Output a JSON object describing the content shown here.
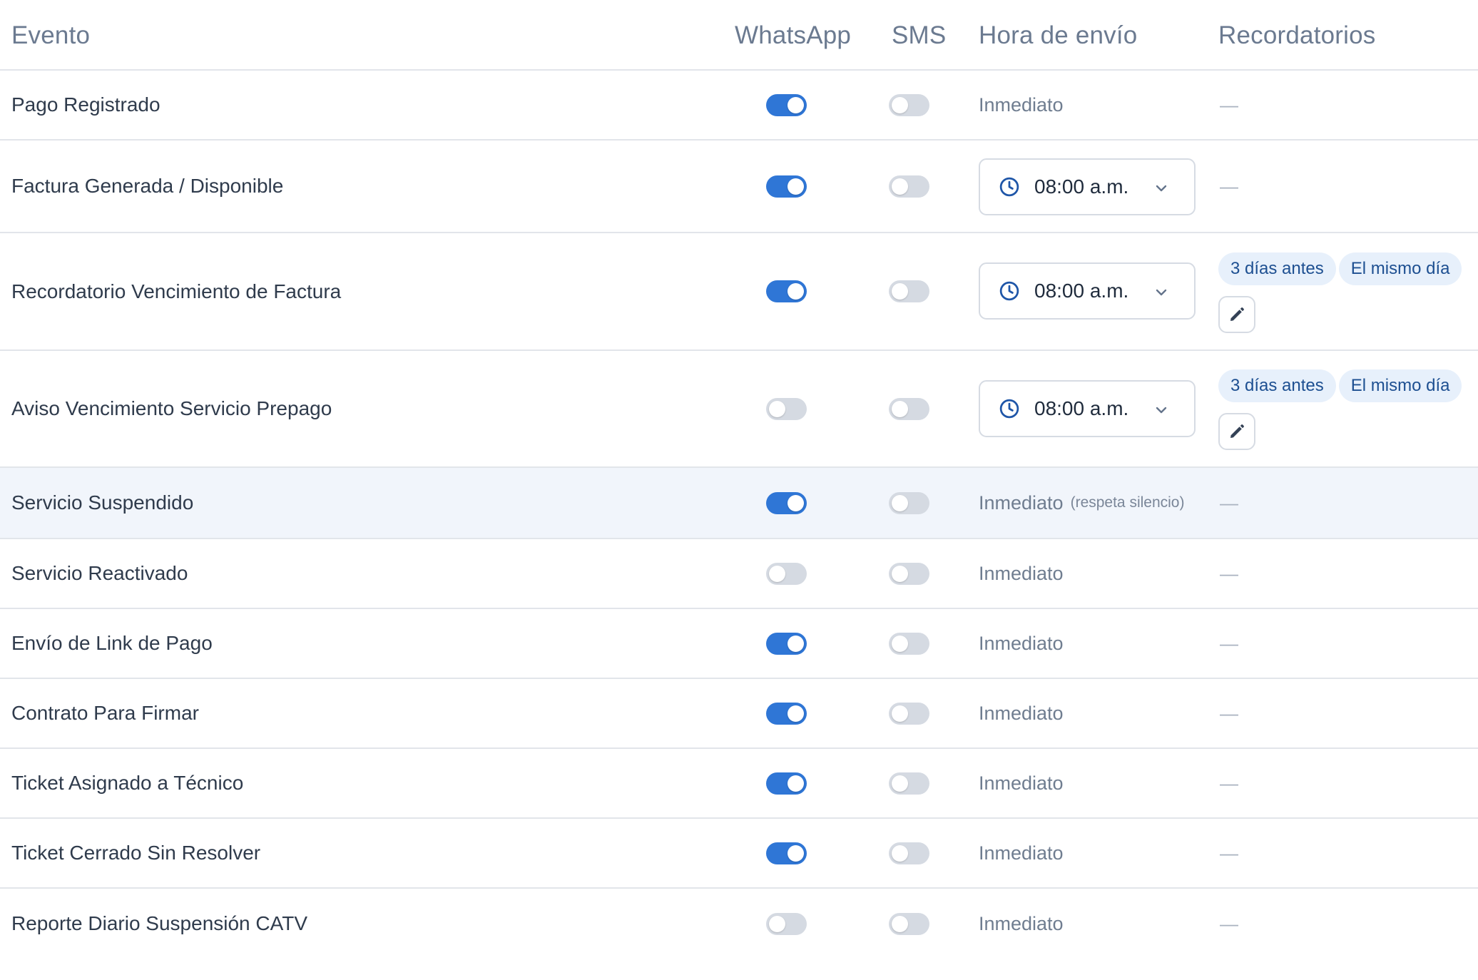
{
  "header": {
    "event": "Evento",
    "whatsapp": "WhatsApp",
    "sms": "SMS",
    "send_time": "Hora de envío",
    "reminders": "Recordatorios"
  },
  "rows": [
    {
      "event": "Pago Registrado",
      "whatsapp": true,
      "sms": false,
      "send": "Inmediato",
      "reminders": "—"
    },
    {
      "event": "Factura Generada / Disponible",
      "whatsapp": true,
      "sms": false,
      "time": "08:00 a.m.",
      "reminders": "—"
    },
    {
      "event": "Recordatorio Vencimiento de Factura",
      "whatsapp": true,
      "sms": false,
      "time": "08:00 a.m.",
      "chips": [
        "3 días antes",
        "El mismo día"
      ]
    },
    {
      "event": "Aviso Vencimiento Servicio Prepago",
      "whatsapp": false,
      "sms": false,
      "time": "08:00 a.m.",
      "chips": [
        "3 días antes",
        "El mismo día"
      ]
    },
    {
      "event": "Servicio Suspendido",
      "whatsapp": true,
      "sms": false,
      "send": "Inmediato",
      "send_note": "(respeta silencio)",
      "reminders": "—"
    },
    {
      "event": "Servicio Reactivado",
      "whatsapp": false,
      "sms": false,
      "send": "Inmediato",
      "reminders": "—"
    },
    {
      "event": "Envío de Link de Pago",
      "whatsapp": true,
      "sms": false,
      "send": "Inmediato",
      "reminders": "—"
    },
    {
      "event": "Contrato Para Firmar",
      "whatsapp": true,
      "sms": false,
      "send": "Inmediato",
      "reminders": "—"
    },
    {
      "event": "Ticket Asignado a Técnico",
      "whatsapp": true,
      "sms": false,
      "send": "Inmediato",
      "reminders": "—"
    },
    {
      "event": "Ticket Cerrado Sin Resolver",
      "whatsapp": true,
      "sms": false,
      "send": "Inmediato",
      "reminders": "—"
    },
    {
      "event": "Reporte Diario Suspensión CATV",
      "whatsapp": false,
      "sms": false,
      "send": "Inmediato",
      "reminders": "—"
    }
  ],
  "colors": {
    "toggle_on": "#2f76d6",
    "toggle_off": "#d5dae2",
    "chip_bg": "#e7f0fb",
    "chip_text": "#1d4f91",
    "highlight_row": "#f1f5fb"
  },
  "icons": {
    "time_selector": "clock-icon",
    "dropdown": "chevron-down-icon",
    "edit": "pencil-icon"
  }
}
